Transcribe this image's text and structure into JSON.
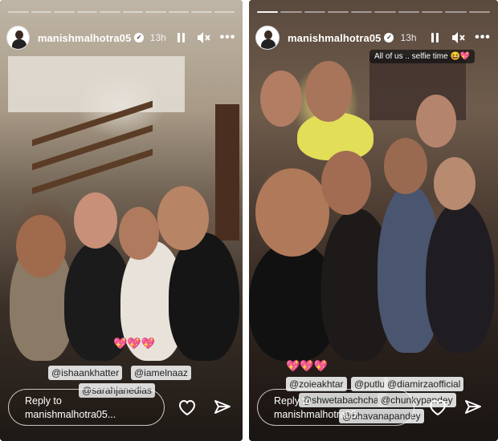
{
  "stories": [
    {
      "username": "manishmalhotra05",
      "timestamp": "13h",
      "progress": {
        "segments": 10,
        "filled": 0
      },
      "mentions": [
        "@ishaankhatter",
        "@iamelnaaz",
        "@sarahjanedias"
      ],
      "emoji": "💖💖💖",
      "reply_placeholder": "Reply to manishmalhotra05..."
    },
    {
      "username": "manishmalhotra05",
      "timestamp": "13h",
      "progress": {
        "segments": 10,
        "filled": 1
      },
      "caption": "All of us .. selfie time 😆💖",
      "mentions": [
        "@zoieakhtar",
        "@putlu",
        "@diamirzaofficial",
        "@shwetabachchan",
        "@chunkypandey",
        "@bhavanapandey"
      ],
      "emoji": "💖💖💖",
      "reply_placeholder": "Reply to manishmalhotra05..."
    }
  ],
  "icons": {
    "pause": "pause-icon",
    "mute": "speaker-muted-icon",
    "more": "more-options-icon",
    "like": "heart-icon",
    "share": "send-icon"
  }
}
